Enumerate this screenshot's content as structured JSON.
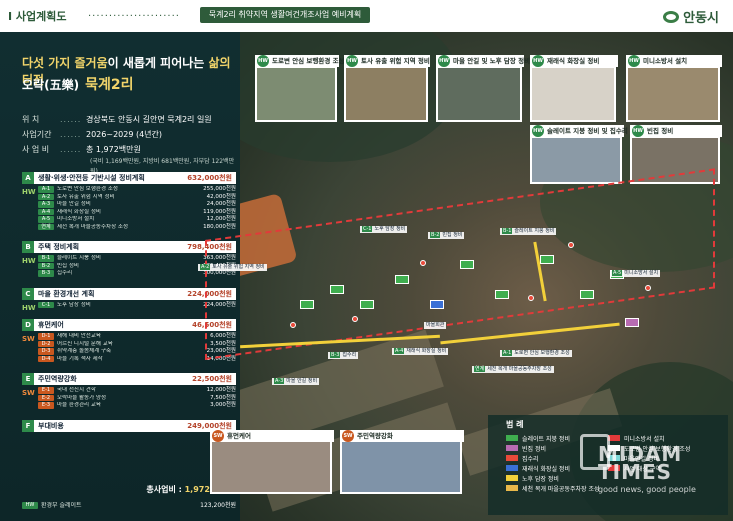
{
  "header": {
    "section_tag": "Ⅰ 사업계획도",
    "dots": "......................",
    "doc_title": "묵계2리 취약지역 생활여건개조사업 예비계획",
    "org": "안동시"
  },
  "intro": {
    "headline_pre": "다섯 가지 즐거움",
    "headline_mid": "이 새롭게 피어나는 ",
    "headline_post": "삶의 터전",
    "title_prefix": "오락(五樂)",
    "title_village": "묵계2리"
  },
  "info": {
    "location_label": "위 치",
    "location_value": "경상북도 안동시 길안면 묵계2리 일원",
    "period_label": "사업기간",
    "period_value": "2026~2029 (4년간)",
    "budget_label": "사 업 비",
    "budget_value": "총 1,972백만원",
    "budget_detail": "(국비 1,169백만원, 지방비 681백만원, 자부담 122백만원)"
  },
  "sections": [
    {
      "letter": "A",
      "label": "생활·위생·안전등 기반시설 정비계획",
      "amount": "632,000천원",
      "side": "HW",
      "items": [
        {
          "code": "A-1",
          "name": "도로변 안심 보행환경 조성",
          "money": "255,000천원"
        },
        {
          "code": "A-2",
          "name": "토사 유출 위험 지역 정비",
          "money": "42,000천원"
        },
        {
          "code": "A-3",
          "name": "마을 안길 정비",
          "money": "24,000천원"
        },
        {
          "code": "A-4",
          "name": "재래식 화장실 정비",
          "money": "119,000천원"
        },
        {
          "code": "A-5",
          "name": "미니소방서 설치",
          "money": "12,000천원"
        },
        {
          "code": "연계",
          "name": "세천 복개 마을공동주차장 조성",
          "money": "180,000천원"
        }
      ]
    },
    {
      "letter": "B",
      "label": "주택 정비계획",
      "amount": "798,400천원",
      "side": "HW",
      "items": [
        {
          "code": "B-1",
          "name": "슬레이트 지붕 정비",
          "money": "363,000천원"
        },
        {
          "code": "B-2",
          "name": "빈집 정비",
          "money": "135,400천원"
        },
        {
          "code": "B-3",
          "name": "집수리",
          "money": "300,000천원"
        }
      ]
    },
    {
      "letter": "C",
      "label": "마을 환경개선 계획",
      "amount": "224,000천원",
      "side": "HW",
      "items": [
        {
          "code": "C-1",
          "name": "노후 담장 정비",
          "money": "224,000천원"
        }
      ]
    },
    {
      "letter": "D",
      "label": "휴먼케어",
      "amount": "46,500천원",
      "side": "SW",
      "items": [
        {
          "code": "D-1",
          "name": "재해 대비 안전교육",
          "money": "6,000천원"
        },
        {
          "code": "D-2",
          "name": "어르신 디지털 문해 교육",
          "money": "3,500천원"
        },
        {
          "code": "D-3",
          "name": "취약계층 돌봄체계 구축",
          "money": "23,000천원"
        },
        {
          "code": "D-4",
          "name": "마을 기록 책자 제작",
          "money": "14,000천원"
        }
      ]
    },
    {
      "letter": "E",
      "label": "주민역량강화",
      "amount": "22,500천원",
      "side": "SW",
      "items": [
        {
          "code": "E-1",
          "name": "국내 선진지 견학",
          "money": "12,000천원"
        },
        {
          "code": "E-2",
          "name": "오락마을 활동가 양성",
          "money": "7,500천원"
        },
        {
          "code": "E-3",
          "name": "마을 환경관리 교육",
          "money": "3,000천원"
        }
      ]
    },
    {
      "letter": "F",
      "label": "부대비용",
      "amount": "249,000천원",
      "side": "",
      "items": []
    }
  ],
  "total": {
    "label": "총사업비 : ",
    "value": "1,972백만원"
  },
  "extra_row": {
    "code": "HW",
    "name": "환경부 슬레이트",
    "money": "123,200천원"
  },
  "photos": [
    {
      "badge": "HW",
      "label": "도로변 안심 보행환경 조성"
    },
    {
      "badge": "HW",
      "label": "토사 유출 위험 지역 정비"
    },
    {
      "badge": "HW",
      "label": "마을 안길 및 노후 담장 정비"
    },
    {
      "badge": "HW",
      "label": "재래식 화장실 정비"
    },
    {
      "badge": "HW",
      "label": "미니소방서 설치"
    },
    {
      "badge": "HW",
      "label": "슬레이트 지붕 정비 및 집수리"
    },
    {
      "badge": "HW",
      "label": "빈집 정비"
    },
    {
      "badge": "SW",
      "label": "휴먼케어"
    },
    {
      "badge": "SW",
      "label": "주민역량강화"
    }
  ],
  "map_labels": [
    {
      "code": "C-1",
      "text": "노후 담장 정비"
    },
    {
      "code": "B-2",
      "text": "빈집 정비"
    },
    {
      "code": "B-1",
      "text": "슬레이트 지붕 정비"
    },
    {
      "code": "A-2",
      "text": "토사 유출 위험 지역 정비"
    },
    {
      "code": "A-5",
      "text": "미니소방서 설치"
    },
    {
      "code": "A-1",
      "text": "도로변 안심 보행환경 조성"
    },
    {
      "code": "B-3",
      "text": "집수리"
    },
    {
      "code": "A-4",
      "text": "재래식 화장실 정비"
    },
    {
      "code": "A-3",
      "text": "마을 안길 정비"
    },
    {
      "code": "연계",
      "text": "세천 복개 마을공동주차장 조성"
    },
    {
      "code": "",
      "text": "마을회관"
    }
  ],
  "legend": {
    "title": "범 례",
    "items": [
      {
        "label": "슬레이트 지붕 정비",
        "color": "#3fae4f"
      },
      {
        "label": "빈집 정비",
        "color": "#b86bb2"
      },
      {
        "label": "집수리",
        "color": "#e94a3a"
      },
      {
        "label": "재래식 화장실 정비",
        "color": "#3a70d6"
      },
      {
        "label": "노후 담장 정비",
        "color": "#f2d03a"
      },
      {
        "label": "세천 복개 마을공동주차장 조성",
        "color": "#e8b84a"
      },
      {
        "label": "미니소방서 설치",
        "color": "#e23a3a"
      },
      {
        "label": "도로변 안심 보행환경 조성",
        "color": "#ffffff"
      },
      {
        "label": "마을안길 정비",
        "color": "#7dd8d8"
      },
      {
        "label": "사업 대상 구역",
        "color": "#e23a3a"
      }
    ]
  },
  "watermark": {
    "brand": "MIDAM TIMES",
    "slogan": "good news, good people"
  }
}
